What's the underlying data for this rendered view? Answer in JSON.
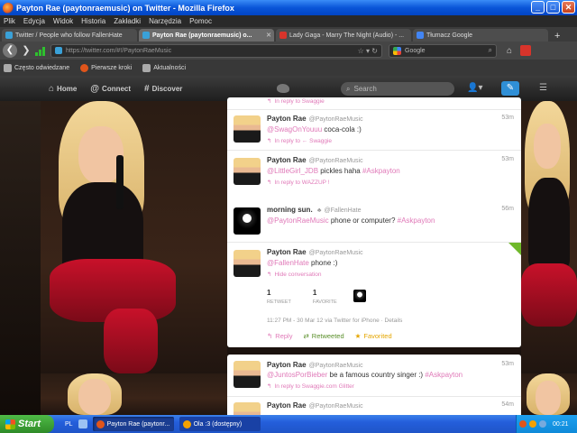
{
  "window": {
    "title": "Payton Rae (paytonraemusic) on Twitter - Mozilla Firefox",
    "controls": {
      "minimize": "_",
      "maximize": "□",
      "close": "✕"
    }
  },
  "menu": [
    "Plik",
    "Edycja",
    "Widok",
    "Historia",
    "Zakładki",
    "Narzędzia",
    "Pomoc"
  ],
  "tabs": [
    {
      "label": "Twitter / People who follow FallenHate",
      "active": false,
      "icon_color": "#3aa1d8"
    },
    {
      "label": "Payton Rae (paytonraemusic) o...",
      "active": true,
      "icon_color": "#3aa1d8"
    },
    {
      "label": "Lady Gaga - Marry The Night (Audio) - ...",
      "active": false,
      "icon_color": "#d8342b"
    },
    {
      "label": "Tłumacz Google",
      "active": false,
      "icon_color": "#4285f4"
    }
  ],
  "navbar": {
    "url": "https://twitter.com/#!/PaytonRaeMusic",
    "search_placeholder": "Google"
  },
  "bookmarks": [
    {
      "label": "Często odwiedzane",
      "icon": "page-icon"
    },
    {
      "label": "Pierwsze kroki",
      "icon": "firefox-icon"
    },
    {
      "label": "Aktualności",
      "icon": "rss-icon"
    }
  ],
  "twitter": {
    "nav": [
      {
        "label": "Home",
        "icon": "⌂"
      },
      {
        "label": "Connect",
        "icon": "@"
      },
      {
        "label": "Discover",
        "icon": "#"
      }
    ],
    "search_placeholder": "Search"
  },
  "tweets": {
    "top_partial_reply": "In reply to Swaggie",
    "t1": {
      "name": "Payton Rae",
      "handle": "@PaytonRaeMusic",
      "time": "53m",
      "mention": "@SwagOnYouuu",
      "text": " coca-cola :)",
      "reply": "In reply to ← Swaggie"
    },
    "t2": {
      "name": "Payton Rae",
      "handle": "@PaytonRaeMusic",
      "time": "53m",
      "mention": "@LittleGirl_JDB",
      "text": " pickles haha ",
      "hashtag": "#Askpayton",
      "reply": "In reply to WAZZUP !"
    },
    "t3": {
      "name": "morning sun.",
      "verified_glyph": "♣",
      "handle": "@FallenHate",
      "time": "56m",
      "mention": "@PaytonRaeMusic",
      "text": " phone or computer? ",
      "hashtag": "#Askpayton"
    },
    "t4": {
      "name": "Payton Rae",
      "handle": "@PaytonRaeMusic",
      "time": "53m",
      "mention": "@FallenHate",
      "text": " phone :)",
      "hide": "Hide conversation",
      "retweets": "1",
      "retweets_label": "RETWEET",
      "favorites": "1",
      "favorites_label": "FAVORITE",
      "meta": "11:27 PM - 30 Mar 12 via Twitter for iPhone · Details",
      "actions": {
        "reply": "Reply",
        "retweeted": "Retweeted",
        "favorited": "Favorited"
      }
    },
    "t5": {
      "name": "Payton Rae",
      "handle": "@PaytonRaeMusic",
      "time": "53m",
      "mention": "@JuntosPorBieber",
      "text": " be a famous country singer :) ",
      "hashtag": "#Askpayton",
      "reply": "In reply to Swaggie.com Glitter"
    },
    "t6": {
      "name": "Payton Rae",
      "handle": "@PaytonRaeMusic",
      "time": "54m"
    }
  },
  "taskbar": {
    "start": "Start",
    "lang": "PL",
    "tasks": [
      {
        "label": "Payton Rae (paytonr...",
        "icon_color": "#e0551b",
        "active": true
      },
      {
        "label": "Ola :3 (dostępny)",
        "icon_color": "#f4a100",
        "active": false
      }
    ],
    "clock": "00:21"
  }
}
